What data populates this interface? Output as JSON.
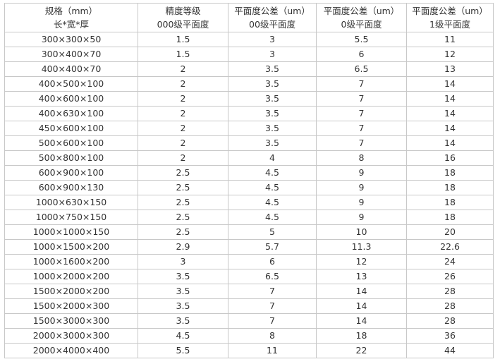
{
  "table": {
    "headers": [
      [
        "规格（mm）",
        "长*宽*厚"
      ],
      [
        "精度等级",
        "000级平面度"
      ],
      [
        "平面度公差（um）",
        "00级平面度"
      ],
      [
        "平面度公差（um）",
        "0级平面度"
      ],
      [
        "平面度公差（um）",
        "1级平面度"
      ]
    ],
    "rows": [
      [
        "300×300×50",
        "1.5",
        "3",
        "5.5",
        "11"
      ],
      [
        "300×400×70",
        "1.5",
        "3",
        "6",
        "12"
      ],
      [
        "400×400×70",
        "2",
        "3.5",
        "6.5",
        "13"
      ],
      [
        "400×500×100",
        "2",
        "3.5",
        "7",
        "14"
      ],
      [
        "400×600×100",
        "2",
        "3.5",
        "7",
        "14"
      ],
      [
        "400×630×100",
        "2",
        "3.5",
        "7",
        "14"
      ],
      [
        "450×600×100",
        "2",
        "3.5",
        "7",
        "14"
      ],
      [
        "500×600×100",
        "2",
        "3.5",
        "7",
        "14"
      ],
      [
        "500×800×100",
        "2",
        "4",
        "8",
        "16"
      ],
      [
        "600×900×100",
        "2.5",
        "4.5",
        "9",
        "18"
      ],
      [
        "600×900×130",
        "2.5",
        "4.5",
        "9",
        "18"
      ],
      [
        "1000×630×150",
        "2.5",
        "4.5",
        "9",
        "18"
      ],
      [
        "1000×750×150",
        "2.5",
        "4.5",
        "9",
        "18"
      ],
      [
        "1000×1000×150",
        "2.5",
        "5",
        "10",
        "20"
      ],
      [
        "1000×1500×200",
        "2.9",
        "5.7",
        "11.3",
        "22.6"
      ],
      [
        "1000×1600×200",
        "3",
        "6",
        "12",
        "24"
      ],
      [
        "1000×2000×200",
        "3.5",
        "6.5",
        "13",
        "26"
      ],
      [
        "1500×2000×200",
        "3.5",
        "7",
        "14",
        "28"
      ],
      [
        "1500×2000×300",
        "3.5",
        "7",
        "14",
        "28"
      ],
      [
        "1500×3000×300",
        "3.5",
        "7",
        "14",
        "28"
      ],
      [
        "2000×3000×300",
        "4.5",
        "8",
        "18",
        "36"
      ],
      [
        "2000×4000×400",
        "5.5",
        "11",
        "22",
        "44"
      ]
    ]
  }
}
